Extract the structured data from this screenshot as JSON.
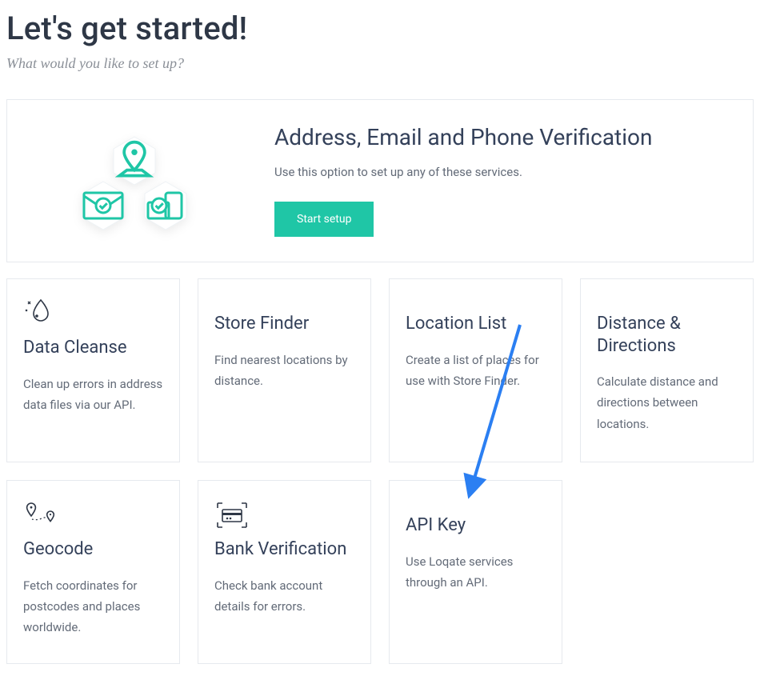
{
  "page": {
    "title": "Let's get started!",
    "subtitle": "What would you like to set up?"
  },
  "featured": {
    "title": "Address, Email and Phone Verification",
    "description": "Use this option to set up any of these services.",
    "button_label": "Start setup"
  },
  "cards": [
    {
      "title": "Data Cleanse",
      "description": "Clean up errors in address data files via our API."
    },
    {
      "title": "Store Finder",
      "description": "Find nearest locations by distance."
    },
    {
      "title": "Location List",
      "description": "Create a list of places for use with Store Finder."
    },
    {
      "title": "Distance & Directions",
      "description": "Calculate distance and directions between locations."
    },
    {
      "title": "Geocode",
      "description": "Fetch coordinates for postcodes and places worldwide."
    },
    {
      "title": "Bank Verification",
      "description": "Check bank account details for errors."
    },
    {
      "title": "API Key",
      "description": "Use Loqate services through an API."
    }
  ]
}
